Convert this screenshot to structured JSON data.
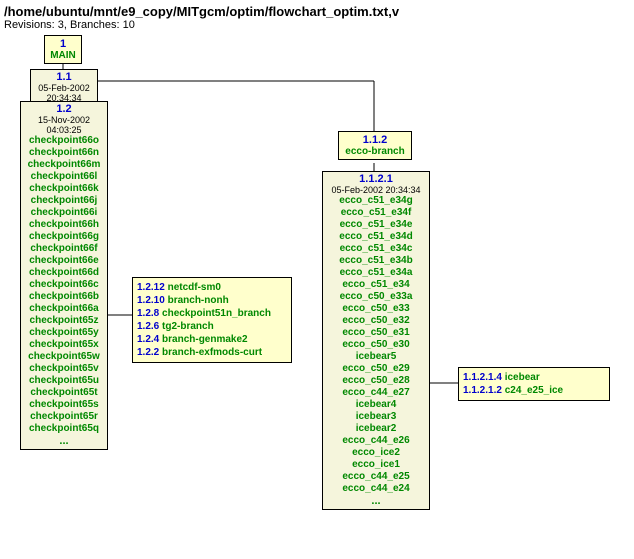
{
  "header": {
    "path": "/home/ubuntu/mnt/e9_copy/MITgcm/optim/flowchart_optim.txt,v",
    "revisions": "Revisions: 3, Branches: 10"
  },
  "root": {
    "rev": "1",
    "label": "MAIN"
  },
  "r11": {
    "rev": "1.1",
    "date": "05-Feb-2002 20:34:34"
  },
  "r12": {
    "rev": "1.2",
    "date": "15-Nov-2002 04:03:25",
    "tags": [
      "checkpoint66o",
      "checkpoint66n",
      "checkpoint66m",
      "checkpoint66l",
      "checkpoint66k",
      "checkpoint66j",
      "checkpoint66i",
      "checkpoint66h",
      "checkpoint66g",
      "checkpoint66f",
      "checkpoint66e",
      "checkpoint66d",
      "checkpoint66c",
      "checkpoint66b",
      "checkpoint66a",
      "checkpoint65z",
      "checkpoint65y",
      "checkpoint65x",
      "checkpoint65w",
      "checkpoint65v",
      "checkpoint65u",
      "checkpoint65t",
      "checkpoint65s",
      "checkpoint65r",
      "checkpoint65q"
    ],
    "dots": "..."
  },
  "r12branches": [
    {
      "num": "1.2.12",
      "name": "netcdf-sm0"
    },
    {
      "num": "1.2.10",
      "name": "branch-nonh"
    },
    {
      "num": "1.2.8",
      "name": "checkpoint51n_branch"
    },
    {
      "num": "1.2.6",
      "name": "tg2-branch"
    },
    {
      "num": "1.2.4",
      "name": "branch-genmake2"
    },
    {
      "num": "1.2.2",
      "name": "branch-exfmods-curt"
    }
  ],
  "ecco": {
    "rev": "1.1.2",
    "label": "ecco-branch"
  },
  "r1121": {
    "rev": "1.1.2.1",
    "date": "05-Feb-2002 20:34:34",
    "tags": [
      "ecco_c51_e34g",
      "ecco_c51_e34f",
      "ecco_c51_e34e",
      "ecco_c51_e34d",
      "ecco_c51_e34c",
      "ecco_c51_e34b",
      "ecco_c51_e34a",
      "ecco_c51_e34",
      "ecco_c50_e33a",
      "ecco_c50_e33",
      "ecco_c50_e32",
      "ecco_c50_e31",
      "ecco_c50_e30",
      "icebear5",
      "ecco_c50_e29",
      "ecco_c50_e28",
      "ecco_c44_e27",
      "icebear4",
      "icebear3",
      "icebear2",
      "ecco_c44_e26",
      "ecco_ice2",
      "ecco_ice1",
      "ecco_c44_e25",
      "ecco_c44_e24"
    ],
    "dots": "..."
  },
  "sidebranches": [
    {
      "num": "1.1.2.1.4",
      "name": "icebear"
    },
    {
      "num": "1.1.2.1.2",
      "name": "c24_e25_ice"
    }
  ]
}
